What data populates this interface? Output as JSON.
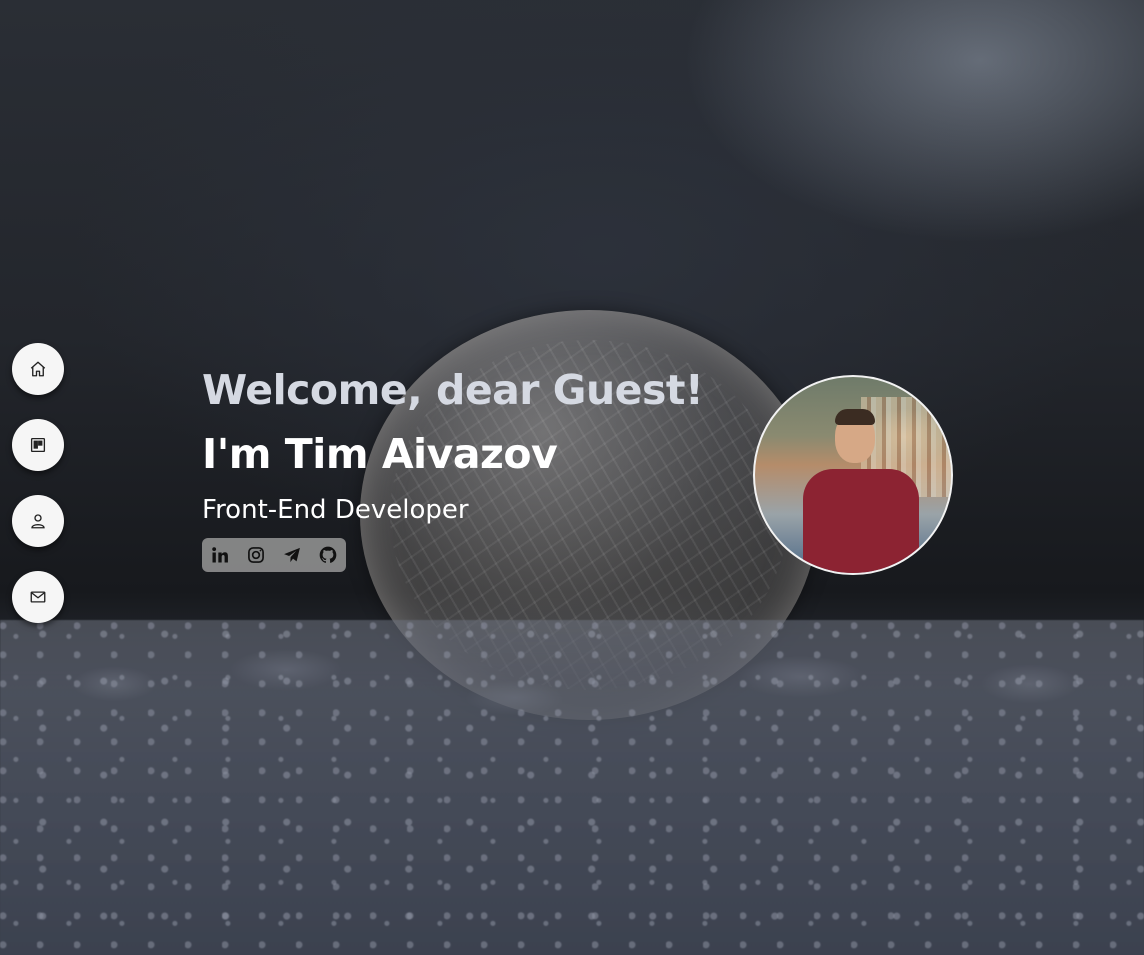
{
  "hero": {
    "greeting": "Welcome, dear Guest!",
    "name": "I'm Tim Aivazov",
    "role": "Front-End Developer"
  },
  "nav": {
    "items": [
      {
        "icon": "home-icon"
      },
      {
        "icon": "board-icon"
      },
      {
        "icon": "user-icon"
      },
      {
        "icon": "mail-icon"
      }
    ]
  },
  "socials": [
    {
      "icon": "linkedin-icon"
    },
    {
      "icon": "instagram-icon"
    },
    {
      "icon": "telegram-icon"
    },
    {
      "icon": "github-icon"
    }
  ],
  "avatar": {
    "icon": "avatar-photo"
  },
  "colors": {
    "greeting": "#d5d9e2",
    "name": "#ffffff",
    "nav_button_bg": "#f6f6f6",
    "socials_bg": "#969696"
  }
}
